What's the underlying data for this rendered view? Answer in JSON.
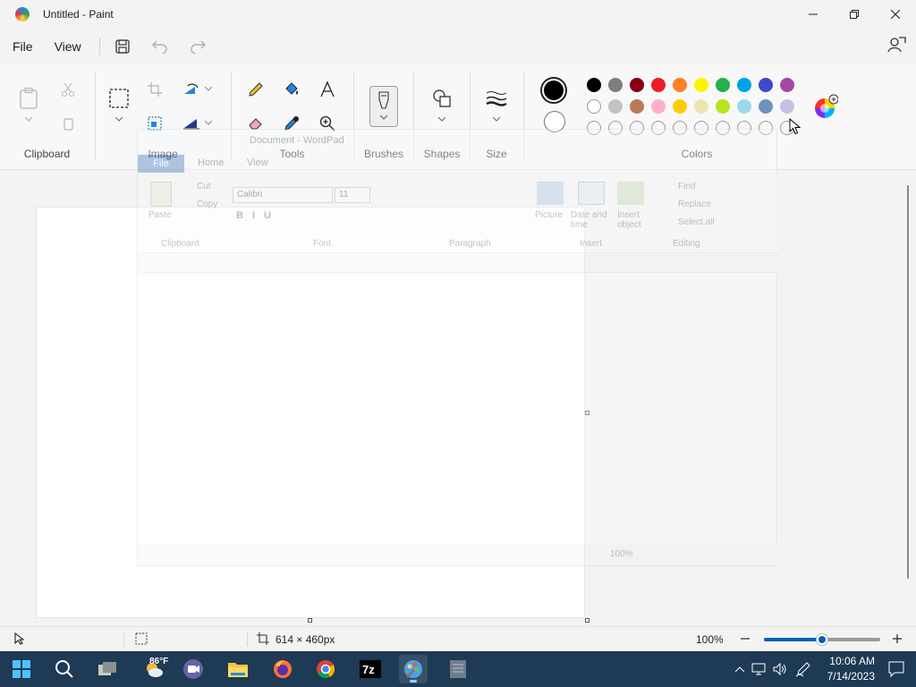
{
  "window": {
    "title": "Untitled - Paint"
  },
  "menu": {
    "file": "File",
    "view": "View"
  },
  "ribbon": {
    "groups": {
      "clipboard": "Clipboard",
      "image": "Image",
      "tools": "Tools",
      "brushes": "Brushes",
      "shapes": "Shapes",
      "size": "Size",
      "colors": "Colors"
    },
    "primary_color": "#000000",
    "secondary_color": "#ffffff",
    "palette_row1": [
      "#000000",
      "#7f7f7f",
      "#880015",
      "#ed1c24",
      "#ff7f27",
      "#fff200",
      "#22b14c",
      "#00a2e8",
      "#3f48cc",
      "#a349a4"
    ],
    "palette_row2": [
      "#ffffff",
      "#c3c3c3",
      "#b97a57",
      "#ffaec9",
      "#ffc90e",
      "#efe4b0",
      "#b5e61d",
      "#99d9ea",
      "#7092be",
      "#c8bfe7"
    ]
  },
  "ghost_wordpad": {
    "title": "Document - WordPad",
    "tab_file": "File",
    "tab_home": "Home",
    "tab_view": "View",
    "font_name": "Calibri",
    "font_size": "11",
    "paste": "Paste",
    "cut": "Cut",
    "copy": "Copy",
    "picture": "Picture",
    "date_time": "Date and time",
    "insert_object": "Insert object",
    "find": "Find",
    "replace": "Replace",
    "select_all": "Select all",
    "grp_clipboard": "Clipboard",
    "grp_font": "Font",
    "grp_paragraph": "Paragraph",
    "grp_insert": "Insert",
    "grp_editing": "Editing",
    "zoom": "100%"
  },
  "status": {
    "canvas_size": "614 × 460px",
    "zoom": "100%",
    "zoom_level": 0.5
  },
  "taskbar": {
    "weather": "86°F",
    "time": "10:06 AM",
    "date": "7/14/2023"
  }
}
